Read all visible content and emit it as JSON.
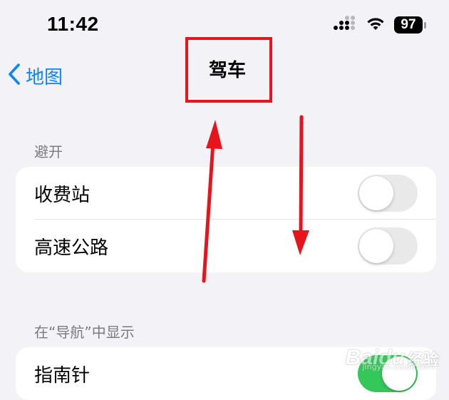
{
  "status_bar": {
    "time": "11:42",
    "battery": "97",
    "icons": [
      "cellular-signal-icon",
      "wifi-icon",
      "battery-icon"
    ]
  },
  "nav": {
    "back_label": "地图",
    "title": "驾车"
  },
  "sections": [
    {
      "header": "避开",
      "rows": [
        {
          "label": "收费站",
          "toggle_on": false
        },
        {
          "label": "高速公路",
          "toggle_on": false
        }
      ]
    },
    {
      "header": "在“导航”中显示",
      "rows": [
        {
          "label": "指南针",
          "toggle_on": true
        }
      ]
    }
  ],
  "annotations": {
    "highlight_color": "#e8141c",
    "arrow_color": "#e8141c"
  },
  "watermark": {
    "main": "Baidu",
    "sub": "jingyan.baidu.com",
    "cn": "经验"
  },
  "colors": {
    "background": "#f2f2f7",
    "accent": "#0a84ff",
    "toggle_off": "#e9e9ea",
    "toggle_on": "#34c759"
  }
}
